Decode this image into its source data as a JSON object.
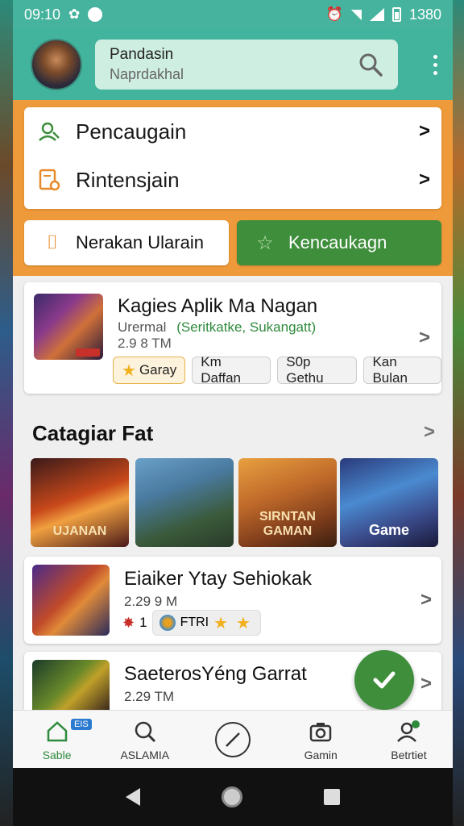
{
  "status_bar": {
    "time": "09:10",
    "clock_right": "1380"
  },
  "header": {
    "name": "Pandasin",
    "search_placeholder": "Naprdakhal"
  },
  "menu": {
    "items": [
      {
        "label": "Pencaugain",
        "icon": "profile-search-icon"
      },
      {
        "label": "Rintensjain",
        "icon": "document-settings-icon"
      }
    ]
  },
  "actions": {
    "left_label": "Nerakan Ularain",
    "right_label": "Kencaukagn"
  },
  "featured_app": {
    "title": "Kagies Aplik Ma Nagan",
    "category": "Urermal",
    "tags_text": "(Seritkatke, Sukangatt)",
    "size": "2.9 8 TM",
    "chips": [
      {
        "label": "Garay",
        "selected": true
      },
      {
        "label": "Km Daffan",
        "selected": false
      },
      {
        "label": "S0p Gethu",
        "selected": false
      },
      {
        "label": "Kan Bulan",
        "selected": false
      }
    ]
  },
  "section": {
    "title": "Catagiar Fat"
  },
  "tiles": [
    {
      "caption": "UJANAN"
    },
    {
      "caption": ""
    },
    {
      "caption": "SIRNTAN GAMAN"
    },
    {
      "caption": "Game"
    }
  ],
  "list": [
    {
      "title": "Eiaiker Ytay Sehiokak",
      "size": "2.29 9 M",
      "badge_count": "1",
      "badge_text": "FTRI"
    },
    {
      "title": "SaeterosYéng Garrat",
      "size": "2.29 TM"
    }
  ],
  "bottom_nav": [
    {
      "label": "Sable",
      "badge": "EIS",
      "active": true
    },
    {
      "label": "ASLAMIA",
      "active": false
    },
    {
      "label": "",
      "active": false
    },
    {
      "label": "Gamin",
      "active": false
    },
    {
      "label": "Betrtiet",
      "active": false
    }
  ],
  "colors": {
    "teal": "#42b39c",
    "orange": "#ef9a3a",
    "green": "#3e8e3c"
  }
}
